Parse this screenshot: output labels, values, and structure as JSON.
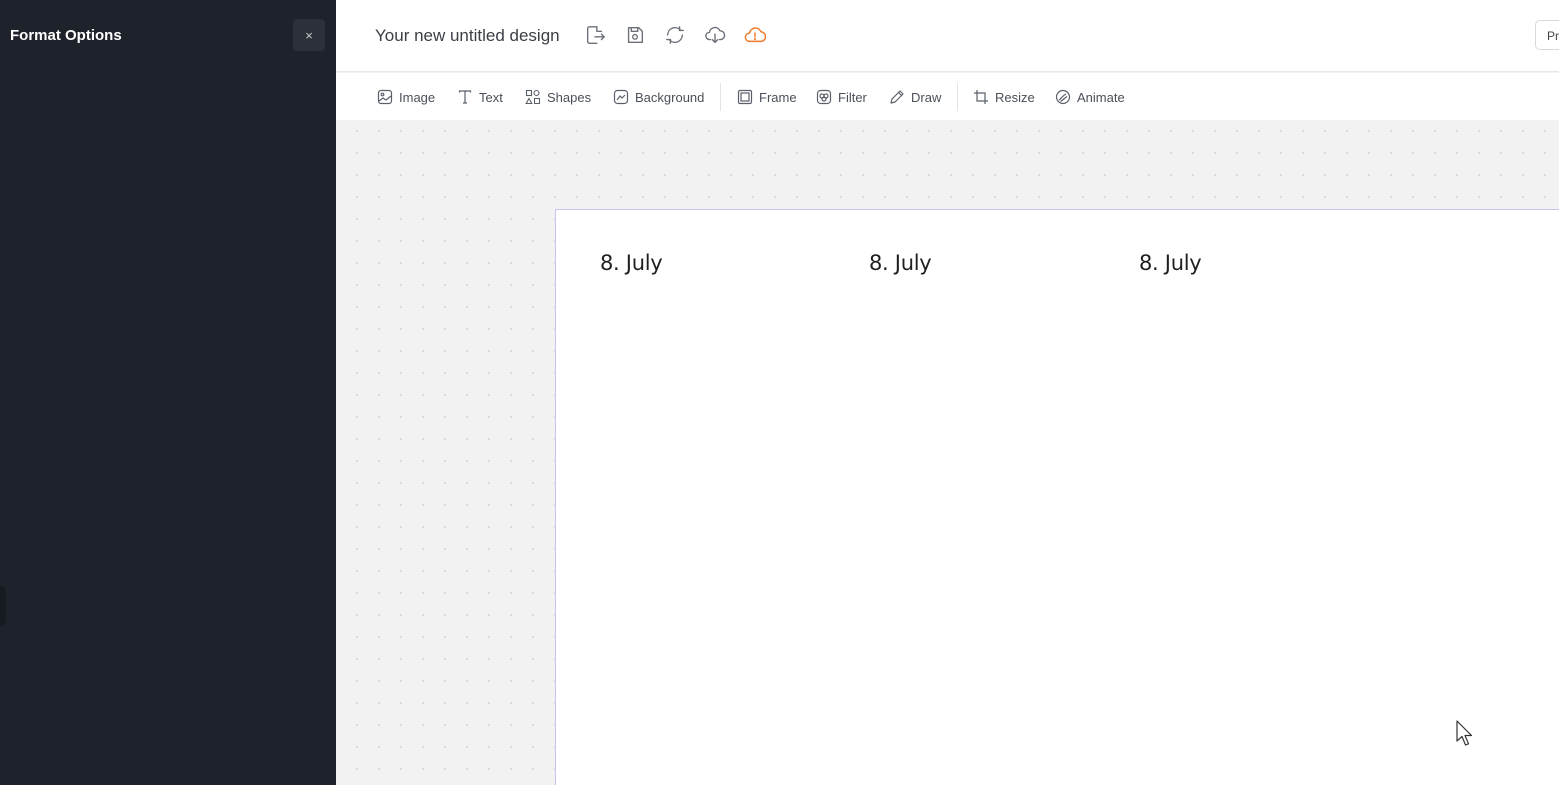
{
  "panel": {
    "title": "Format Options",
    "close_label": "×"
  },
  "header": {
    "design_title": "Your new untitled design",
    "icons": [
      "export-icon",
      "save-icon",
      "sync-icon",
      "download-icon",
      "cloud-warning-icon"
    ],
    "preview_label": "Pr"
  },
  "toolbar": {
    "image": "Image",
    "text": "Text",
    "shapes": "Shapes",
    "background": "Background",
    "frame": "Frame",
    "filter": "Filter",
    "draw": "Draw",
    "resize": "Resize",
    "animate": "Animate"
  },
  "canvas": {
    "texts": [
      "8. July",
      "8. July",
      "8. July"
    ]
  },
  "colors": {
    "panel_bg": "#1e222a",
    "accent_warning": "#f07a2b",
    "artboard_border": "#c6c5ee"
  }
}
